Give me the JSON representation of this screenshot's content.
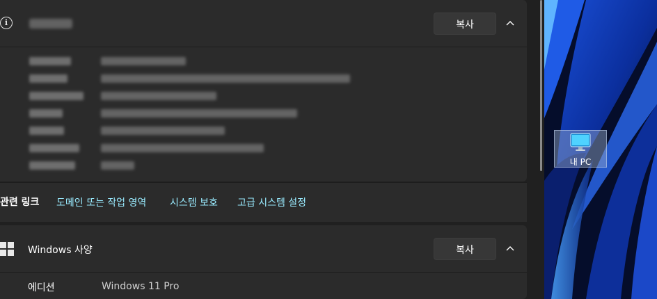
{
  "about_section": {
    "icon": "info-icon",
    "copy_label": "복사",
    "collapse_icon": "chevron-up-icon"
  },
  "related_links": {
    "label": "관련 링크",
    "links": [
      "도메인 또는 작업 영역",
      "시스템 보호",
      "고급 시스템 설정"
    ],
    "link_color": "#99ebff"
  },
  "windows_spec": {
    "icon": "windows-logo-icon",
    "title": "Windows 사양",
    "copy_label": "복사",
    "collapse_icon": "chevron-up-icon",
    "edition_label": "에디션",
    "edition_value": "Windows 11 Pro"
  },
  "desktop": {
    "icon_name": "monitor-icon",
    "icon_label": "내 PC"
  },
  "colors": {
    "background": "#202020",
    "card": "#2b2b2b",
    "button": "#373737",
    "wallpaper": "#06143a"
  }
}
